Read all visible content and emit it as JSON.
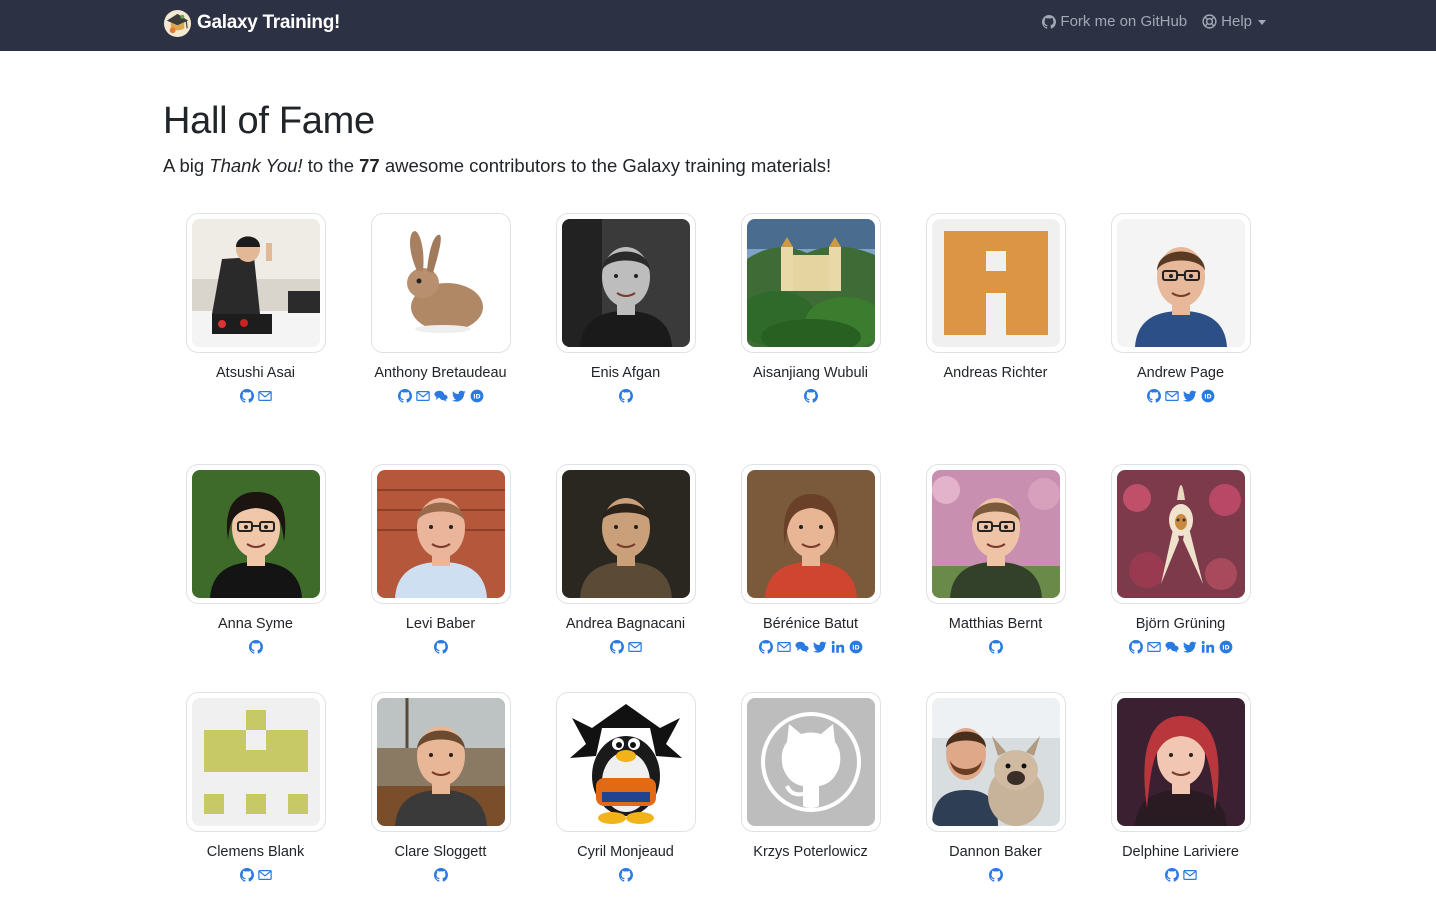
{
  "navbar": {
    "brand": "Galaxy Training!",
    "fork_label": "Fork me on GitHub",
    "help_label": "Help"
  },
  "page": {
    "title": "Hall of Fame",
    "lead_prefix": "A big ",
    "lead_em": "Thank You!",
    "lead_mid": " to the ",
    "lead_count": "77",
    "lead_suffix": " awesome contributors to the Galaxy training materials!"
  },
  "colors": {
    "navbar_bg": "#2c3143",
    "link": "#2a7ae2"
  },
  "contributors": [
    {
      "name": "Atsushi Asai",
      "avatar": "photo-person-posing",
      "links": [
        "github",
        "email"
      ]
    },
    {
      "name": "Anthony Bretaudeau",
      "avatar": "rabbit",
      "links": [
        "github",
        "email",
        "chat",
        "twitter",
        "orcid"
      ]
    },
    {
      "name": "Enis Afgan",
      "avatar": "photo-bw-portrait",
      "links": [
        "github"
      ]
    },
    {
      "name": "Aisanjiang Wubuli",
      "avatar": "castle",
      "links": [
        "github"
      ]
    },
    {
      "name": "Andreas Richter",
      "avatar": "identicon-orange",
      "links": []
    },
    {
      "name": "Andrew Page",
      "avatar": "photo-glasses-man",
      "links": [
        "github",
        "email",
        "twitter",
        "orcid"
      ]
    },
    {
      "name": "Anna Syme",
      "avatar": "photo-woman-glasses",
      "links": [
        "github"
      ]
    },
    {
      "name": "Levi Baber",
      "avatar": "photo-man-brick",
      "links": [
        "github"
      ]
    },
    {
      "name": "Andrea Bagnacani",
      "avatar": "photo-man-dark",
      "links": [
        "github",
        "email"
      ]
    },
    {
      "name": "Bérénice Batut",
      "avatar": "photo-woman",
      "links": [
        "github",
        "email",
        "chat",
        "twitter",
        "linkedin",
        "orcid"
      ]
    },
    {
      "name": "Matthias Bernt",
      "avatar": "photo-man-blossoms",
      "links": [
        "github"
      ]
    },
    {
      "name": "Björn Grüning",
      "avatar": "orchid",
      "links": [
        "github",
        "email",
        "chat",
        "twitter",
        "linkedin",
        "orcid"
      ]
    },
    {
      "name": "Clemens Blank",
      "avatar": "identicon-olive",
      "links": [
        "github",
        "email"
      ]
    },
    {
      "name": "Clare Sloggett",
      "avatar": "photo-woman-ship",
      "links": [
        "github"
      ]
    },
    {
      "name": "Cyril Monjeaud",
      "avatar": "penguin-cartoon",
      "links": [
        "github"
      ]
    },
    {
      "name": "Krzys Poterlowicz",
      "avatar": "octocat",
      "links": []
    },
    {
      "name": "Dannon Baker",
      "avatar": "photo-man-dog",
      "links": [
        "github"
      ]
    },
    {
      "name": "Delphine Lariviere",
      "avatar": "photo-woman-red-hair",
      "links": [
        "github",
        "email"
      ]
    }
  ]
}
